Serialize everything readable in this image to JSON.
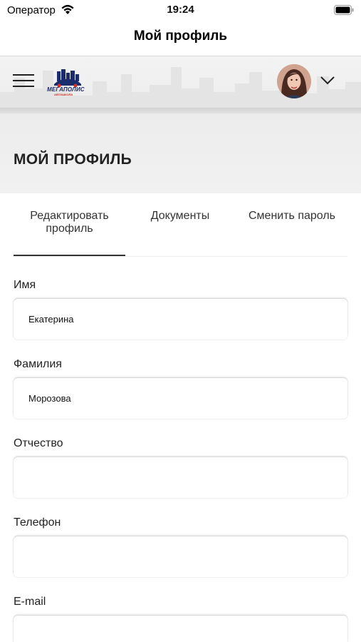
{
  "status_bar": {
    "carrier": "Оператор",
    "time": "19:24",
    "wifi_icon": "wifi-icon",
    "battery_icon": "battery-icon"
  },
  "nav": {
    "title": "Мой профиль"
  },
  "header": {
    "menu_icon": "hamburger-menu-icon",
    "logo": {
      "name": "МЕГАПОЛИС",
      "sub": "АВТОШКОЛА"
    },
    "avatar": "user-avatar",
    "chevron_icon": "chevron-down-icon"
  },
  "page": {
    "title": "МОЙ ПРОФИЛЬ"
  },
  "tabs": [
    {
      "label": "Редактировать профиль",
      "active": true
    },
    {
      "label": "Документы",
      "active": false
    },
    {
      "label": "Сменить пароль",
      "active": false
    }
  ],
  "form": {
    "fields": [
      {
        "label": "Имя",
        "value": "Екатерина"
      },
      {
        "label": "Фамилия",
        "value": "Морозова"
      },
      {
        "label": "Отчество",
        "value": ""
      },
      {
        "label": "Телефон",
        "value": ""
      },
      {
        "label": "E-mail",
        "value": ""
      }
    ]
  },
  "colors": {
    "accent": "#333333",
    "brand_blue": "#1c2d6e",
    "brand_red": "#d6302a",
    "header_bg": "#efefef"
  }
}
